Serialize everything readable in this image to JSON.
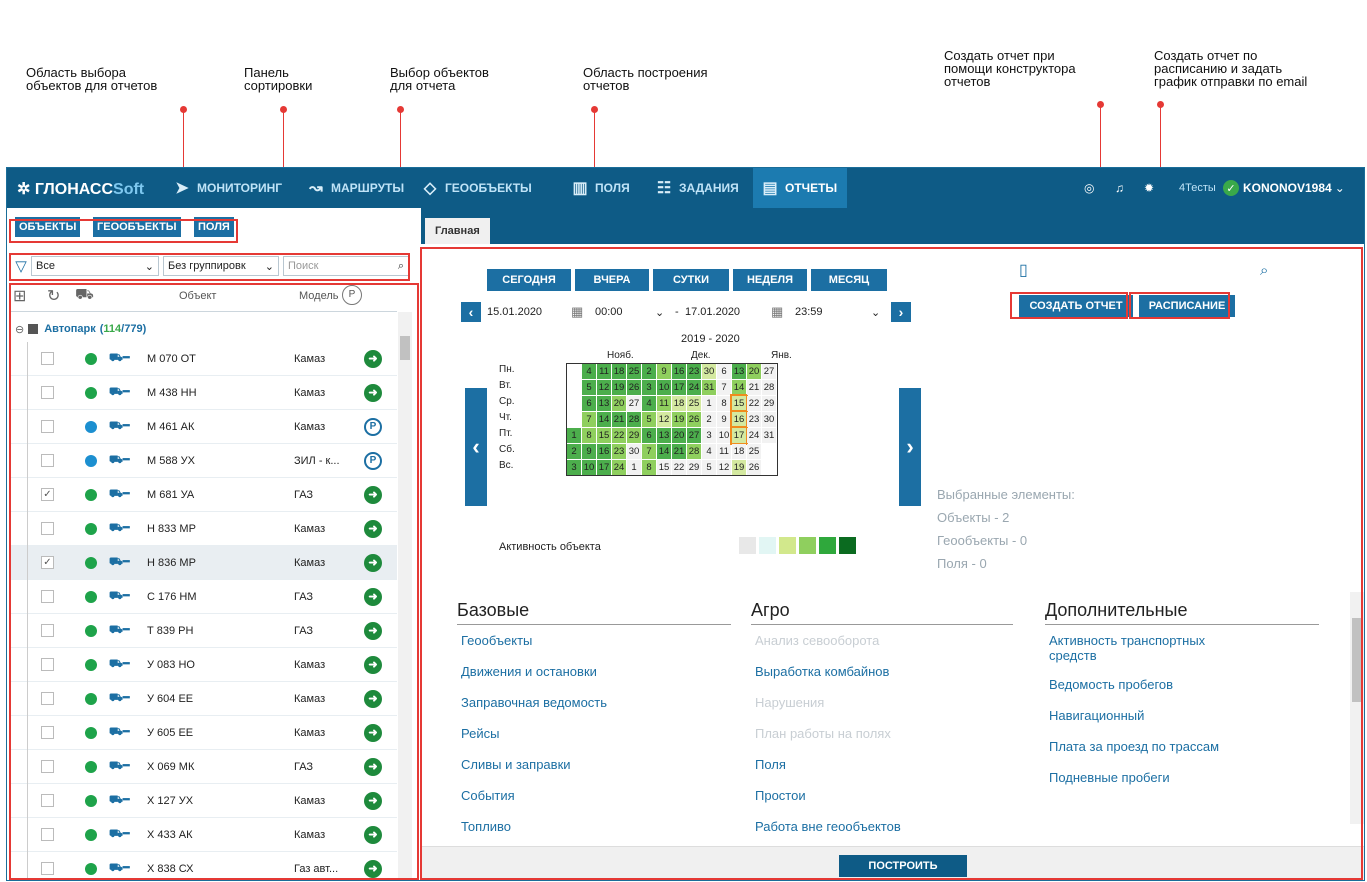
{
  "callouts": [
    {
      "text": "Область выбора\nобъектов для отчетов"
    },
    {
      "text": "Панель\nсортировки"
    },
    {
      "text": "Выбор объектов\nдля отчета"
    },
    {
      "text": "Область построения\nотчетов"
    },
    {
      "text": "Создать отчет при\nпомощи конструктора\nотчетов"
    },
    {
      "text": "Создать отчет по\nрасписанию и задать\nграфик отправки по email"
    }
  ],
  "topbar": {
    "logo_main": "ГЛОНАСС",
    "logo_soft": "Soft",
    "nav": [
      {
        "label": "МОНИТОРИНГ",
        "icon": "send-icon"
      },
      {
        "label": "МАРШРУТЫ",
        "icon": "route-icon"
      },
      {
        "label": "ГЕООБЪЕКТЫ",
        "icon": "geoobject-icon"
      },
      {
        "label": "ПОЛЯ",
        "icon": "fields-icon"
      },
      {
        "label": "ЗАДАНИЯ",
        "icon": "tasks-icon"
      },
      {
        "label": "ОТЧЕТЫ",
        "icon": "reports-icon"
      }
    ],
    "account": "4Тесты",
    "user": "KONONOV1984"
  },
  "left": {
    "tabs": [
      "ОБЪЕКТЫ",
      "ГЕООБЪЕКТЫ",
      "ПОЛЯ"
    ],
    "filter_value": "Все",
    "group_value": "Без группировк",
    "search_placeholder": "Поиск",
    "col_object": "Объект",
    "col_model": "Модель",
    "group_name": "Автопарк",
    "group_active": "114",
    "group_total": "/779)",
    "rows": [
      {
        "name": "М 070 ОТ",
        "model": "Камаз",
        "status": "go",
        "checked": false,
        "dot": "#1ea34a"
      },
      {
        "name": "М 438 НН",
        "model": "Камаз",
        "status": "go",
        "checked": false,
        "dot": "#1ea34a"
      },
      {
        "name": "М 461 АК",
        "model": "Камаз",
        "status": "park",
        "checked": false,
        "dot": "#1c8fd0"
      },
      {
        "name": "М 588 УХ",
        "model": "ЗИЛ - к...",
        "status": "park",
        "checked": false,
        "dot": "#1c8fd0"
      },
      {
        "name": "М 681 УА",
        "model": "ГАЗ",
        "status": "go",
        "checked": true,
        "dot": "#1ea34a"
      },
      {
        "name": "Н 833 МР",
        "model": "Камаз",
        "status": "go",
        "checked": false,
        "dot": "#1ea34a"
      },
      {
        "name": "Н 836 МР",
        "model": "Камаз",
        "status": "go",
        "checked": true,
        "dot": "#1ea34a"
      },
      {
        "name": "С 176 НМ",
        "model": "ГАЗ",
        "status": "go",
        "checked": false,
        "dot": "#1ea34a"
      },
      {
        "name": "Т 839 РН",
        "model": "ГАЗ",
        "status": "go",
        "checked": false,
        "dot": "#1ea34a"
      },
      {
        "name": "У 083 НО",
        "model": "Камаз",
        "status": "go",
        "checked": false,
        "dot": "#1ea34a"
      },
      {
        "name": "У 604 ЕЕ",
        "model": "Камаз",
        "status": "go",
        "checked": false,
        "dot": "#1ea34a"
      },
      {
        "name": "У 605 ЕЕ",
        "model": "Камаз",
        "status": "go",
        "checked": false,
        "dot": "#1ea34a"
      },
      {
        "name": "Х 069 МК",
        "model": "ГАЗ",
        "status": "go",
        "checked": false,
        "dot": "#1ea34a"
      },
      {
        "name": "Х 127 УХ",
        "model": "Камаз",
        "status": "go",
        "checked": false,
        "dot": "#1ea34a"
      },
      {
        "name": "Х 433 АК",
        "model": "Камаз",
        "status": "go",
        "checked": false,
        "dot": "#1ea34a"
      },
      {
        "name": "Х 838 СХ",
        "model": "Газ авт...",
        "status": "go",
        "checked": false,
        "dot": "#1ea34a"
      }
    ]
  },
  "main": {
    "tab": "Главная",
    "periods": [
      "СЕГОДНЯ",
      "ВЧЕРА",
      "СУТКИ",
      "НЕДЕЛЯ",
      "МЕСЯЦ"
    ],
    "date_from": "15.01.2020",
    "time_from": "00:00",
    "date_to": "17.01.2020",
    "time_to": "23:59",
    "dash": "-",
    "create_report": "СОЗДАТЬ ОТЧЕТ",
    "schedule": "РАСПИСАНИЕ",
    "calendar_title": "2019 - 2020",
    "months": [
      "Нояб.",
      "Дек.",
      "Янв."
    ],
    "weekdays": [
      "Пн.",
      "Вт.",
      "Ср.",
      "Чт.",
      "Пт.",
      "Сб.",
      "Вс."
    ],
    "calendar_cols": [
      [
        "",
        "",
        "",
        "",
        "1",
        "2",
        "3"
      ],
      [
        "4",
        "5",
        "6",
        "7",
        "8",
        "9",
        "10"
      ],
      [
        "11",
        "12",
        "13",
        "14",
        "15",
        "16",
        "17"
      ],
      [
        "18",
        "19",
        "20",
        "21",
        "22",
        "23",
        "24"
      ],
      [
        "25",
        "26",
        "27",
        "28",
        "29",
        "30",
        "1"
      ],
      [
        "2",
        "3",
        "4",
        "5",
        "6",
        "7",
        "8"
      ],
      [
        "9",
        "10",
        "11",
        "12",
        "13",
        "14",
        "15"
      ],
      [
        "16",
        "17",
        "18",
        "19",
        "20",
        "21",
        "22"
      ],
      [
        "23",
        "24",
        "25",
        "26",
        "27",
        "28",
        "29"
      ],
      [
        "30",
        "31",
        "1",
        "2",
        "3",
        "4",
        "5"
      ],
      [
        "6",
        "7",
        "8",
        "9",
        "10",
        "11",
        "12"
      ],
      [
        "13",
        "14",
        "15",
        "16",
        "17",
        "18",
        "19"
      ],
      [
        "20",
        "21",
        "22",
        "23",
        "24",
        "25",
        "26"
      ],
      [
        "27",
        "28",
        "29",
        "30",
        "31",
        "",
        ""
      ]
    ],
    "calendar_levels": [
      [
        0,
        0,
        0,
        0,
        4,
        4,
        4
      ],
      [
        4,
        4,
        4,
        3,
        3,
        4,
        4
      ],
      [
        4,
        4,
        4,
        4,
        3,
        4,
        4
      ],
      [
        4,
        4,
        3,
        4,
        3,
        3,
        3
      ],
      [
        4,
        4,
        1,
        4,
        3,
        1,
        1
      ],
      [
        4,
        4,
        4,
        3,
        4,
        3,
        3
      ],
      [
        3,
        4,
        3,
        2,
        4,
        4,
        1
      ],
      [
        4,
        4,
        2,
        3,
        4,
        4,
        1
      ],
      [
        4,
        4,
        2,
        3,
        4,
        3,
        1
      ],
      [
        2,
        3,
        1,
        1,
        1,
        1,
        1
      ],
      [
        1,
        1,
        1,
        1,
        1,
        1,
        1
      ],
      [
        4,
        3,
        2,
        2,
        2,
        1,
        2
      ],
      [
        3,
        1,
        1,
        1,
        1,
        1,
        1
      ],
      [
        1,
        1,
        1,
        1,
        1,
        0,
        0
      ]
    ],
    "level_colors": [
      "#ffffff",
      "#f2f2f2",
      "#d4e9a0",
      "#8fcf5e",
      "#4cae4c"
    ],
    "legend_label": "Активность объекта",
    "legend_colors": [
      "#e8e8e8",
      "#e2f6f4",
      "#d2e88c",
      "#8fcf5e",
      "#2fa83c",
      "#0b6b20"
    ],
    "selected_title": "Выбранные элементы:",
    "selected_objects": "Объекты - 2",
    "selected_geo": "Геообъекты - 0",
    "selected_fields": "Поля - 0",
    "sections": [
      {
        "title": "Базовые",
        "links": [
          {
            "t": "Геообъекты",
            "d": false
          },
          {
            "t": "Движения и остановки",
            "d": false
          },
          {
            "t": "Заправочная ведомость",
            "d": false
          },
          {
            "t": "Рейсы",
            "d": false
          },
          {
            "t": "Сливы и заправки",
            "d": false
          },
          {
            "t": "События",
            "d": false
          },
          {
            "t": "Топливо",
            "d": false
          }
        ]
      },
      {
        "title": "Агро",
        "links": [
          {
            "t": "Анализ севооборота",
            "d": true
          },
          {
            "t": "Выработка комбайнов",
            "d": false
          },
          {
            "t": "Нарушения",
            "d": true
          },
          {
            "t": "План работы на полях",
            "d": true
          },
          {
            "t": "Поля",
            "d": false
          },
          {
            "t": "Простои",
            "d": false
          },
          {
            "t": "Работа вне геообъектов",
            "d": false
          }
        ]
      },
      {
        "title": "Дополнительные",
        "links": [
          {
            "t": "Активность транспортных\nсредств",
            "d": false
          },
          {
            "t": "Ведомость пробегов",
            "d": false
          },
          {
            "t": "Навигационный",
            "d": false
          },
          {
            "t": "Плата за проезд по трассам",
            "d": false
          },
          {
            "t": "Подневные пробеги",
            "d": false
          }
        ]
      }
    ],
    "build": "ПОСТРОИТЬ"
  },
  "colors": {
    "navbar": "#0e5b86",
    "accent": "#1c6fa3",
    "annotation": "#e53935"
  }
}
